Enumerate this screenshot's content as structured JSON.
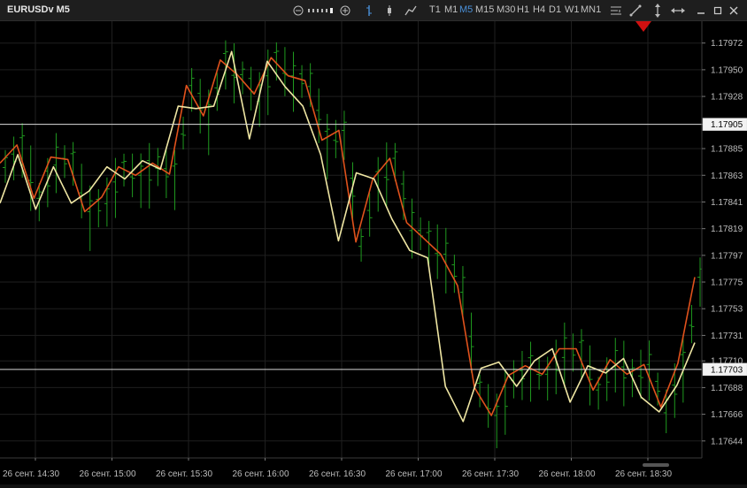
{
  "window": {
    "title": "EURUSDv M5"
  },
  "toolbar": {
    "timeframes": [
      "T1",
      "M1",
      "M5",
      "M15",
      "M30",
      "H1",
      "H4",
      "D1",
      "W1",
      "MN1"
    ],
    "active_timeframe": "M5",
    "icons": [
      "zoom-out-icon",
      "scale-slider",
      "zoom-in-icon",
      "bar-chart-icon",
      "candlestick-icon",
      "line-chart-icon",
      "indicators-icon",
      "draw-trendline-icon",
      "vertical-line-icon",
      "horizontal-line-icon",
      "minimize-icon",
      "maximize-icon",
      "close-icon"
    ]
  },
  "colors": {
    "background": "#000000",
    "grid": "#1f1f1f",
    "bars": "#1f9a1f",
    "line_fast": "#e0521c",
    "line_slow": "#efe6a3",
    "price_line": "#d8d8d8",
    "marker": "#d01010",
    "accent": "#4a90d9"
  },
  "chart_data": {
    "type": "line",
    "symbol": "EURUSDv",
    "timeframe": "M5",
    "x_labels": [
      "26 сент. 14:30",
      "26 сент. 15:00",
      "26 сент. 15:30",
      "26 сент. 16:00",
      "26 сент. 16:30",
      "26 сент. 17:00",
      "26 сент. 17:30",
      "26 сент. 18:00",
      "26 сент. 18:30"
    ],
    "y_ticks": [
      "1.17972",
      "1.17950",
      "1.17928",
      "1.17905",
      "1.17885",
      "1.17863",
      "1.17841",
      "1.17819",
      "1.17797",
      "1.17775",
      "1.17753",
      "1.17731",
      "1.17710",
      "1.17688",
      "1.17666",
      "1.17644"
    ],
    "ylim": [
      1.1763,
      1.1799
    ],
    "grid": true,
    "price_labels": [
      "1.17905",
      "1.17703"
    ],
    "horizontal_lines": [
      1.17905,
      1.17703
    ],
    "series": [
      {
        "values": [
          1.17873,
          1.17888,
          1.17844,
          1.17878,
          1.17876,
          1.17833,
          1.17845,
          1.1787,
          1.17863,
          1.17873,
          1.17864,
          1.17937,
          1.17912,
          1.17958,
          1.17946,
          1.1793,
          1.1796,
          1.17945,
          1.17941,
          1.17892,
          1.179,
          1.17808,
          1.1786,
          1.17877,
          1.17824,
          1.17811,
          1.17798,
          1.17772,
          1.17688,
          1.17665,
          1.17698,
          1.17706,
          1.17699,
          1.1772,
          1.1772,
          1.17686,
          1.17711,
          1.17699,
          1.17707,
          1.17672,
          1.17708,
          1.17779
        ]
      },
      {
        "values": [
          1.1784,
          1.1788,
          1.17835,
          1.1787,
          1.1784,
          1.1785,
          1.1787,
          1.1786,
          1.17875,
          1.17868,
          1.1792,
          1.17918,
          1.1792,
          1.17965,
          1.17893,
          1.17957,
          1.17936,
          1.1792,
          1.1788,
          1.17809,
          1.17865,
          1.1786,
          1.17827,
          1.17801,
          1.17795,
          1.17689,
          1.1766,
          1.17704,
          1.17709,
          1.17689,
          1.1771,
          1.1772,
          1.17676,
          1.17706,
          1.177,
          1.17712,
          1.1768,
          1.17668,
          1.1769,
          1.17725
        ]
      }
    ]
  }
}
